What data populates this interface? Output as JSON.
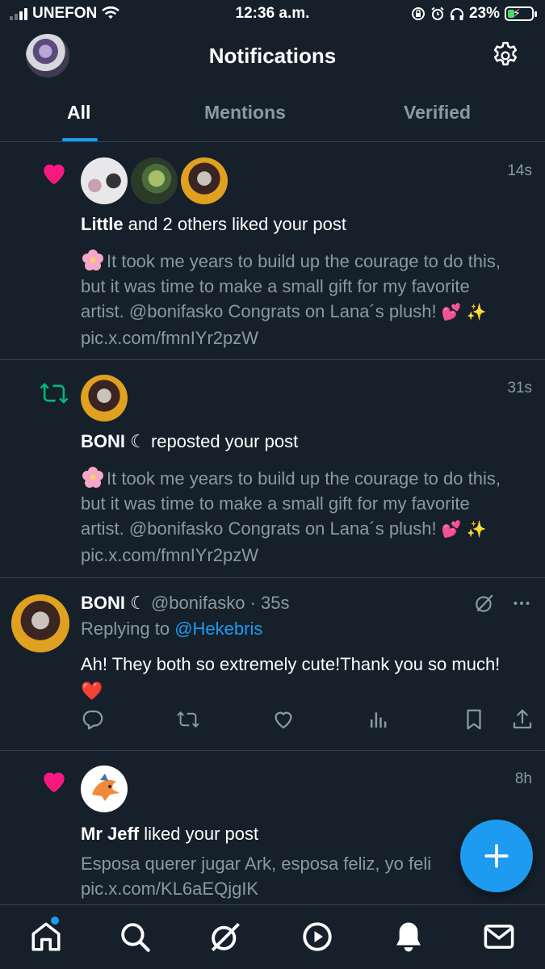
{
  "status_bar": {
    "carrier": "UNEFON",
    "time": "12:36 a.m.",
    "battery": "23%",
    "battery_level": 0.23
  },
  "header": {
    "title": "Notifications"
  },
  "tabs": [
    {
      "label": "All",
      "active": true
    },
    {
      "label": "Mentions",
      "active": false
    },
    {
      "label": "Verified",
      "active": false
    }
  ],
  "notifications": [
    {
      "type": "like",
      "time": "14s",
      "actor": "Little",
      "action_text": " and 2 others liked your post",
      "post_text": "It took me years to build up the courage to do this, but it was time to make a small gift for my favorite artist. @bonifasko Congrats on Lana´s plush! ",
      "post_link": "pic.x.com/fmnIYr2pzW"
    },
    {
      "type": "repost",
      "time": "31s",
      "actor": "BONI ☾",
      "action_text": " reposted your post",
      "post_text": "It took me years to build up the courage to do this, but it was time to make a small gift for my favorite artist. @bonifasko Congrats on Lana´s plush! ",
      "post_link": "pic.x.com/fmnIYr2pzW"
    },
    {
      "type": "reply",
      "name": "BONI ☾",
      "handle": "@bonifasko",
      "separator": " · ",
      "time": "35s",
      "replying_prefix": "Replying to ",
      "replying_to": "@Hekebris",
      "text": "Ah! They both so extremely cute!Thank you so much! ❤️"
    },
    {
      "type": "like",
      "time": "8h",
      "actor": "Mr Jeff",
      "action_text": " liked your post",
      "post_text": "Esposa querer jugar Ark, esposa feliz, yo feli",
      "post_link": "pic.x.com/KL6aEQjgIK"
    }
  ],
  "emojis": {
    "hearts": "💕",
    "sparkles": "✨"
  },
  "icons": {
    "like": "heart-icon",
    "repost": "repost-icon",
    "settings": "gear-icon",
    "compose": "plus-icon"
  },
  "colors": {
    "background": "#15202b",
    "accent": "#1d9bf0",
    "like": "#f91880",
    "repost": "#00ba7c",
    "muted": "#8b98a5"
  },
  "bottom_nav": [
    "home-icon",
    "search-icon",
    "grok-icon",
    "video-icon",
    "notifications-icon",
    "messages-icon"
  ]
}
